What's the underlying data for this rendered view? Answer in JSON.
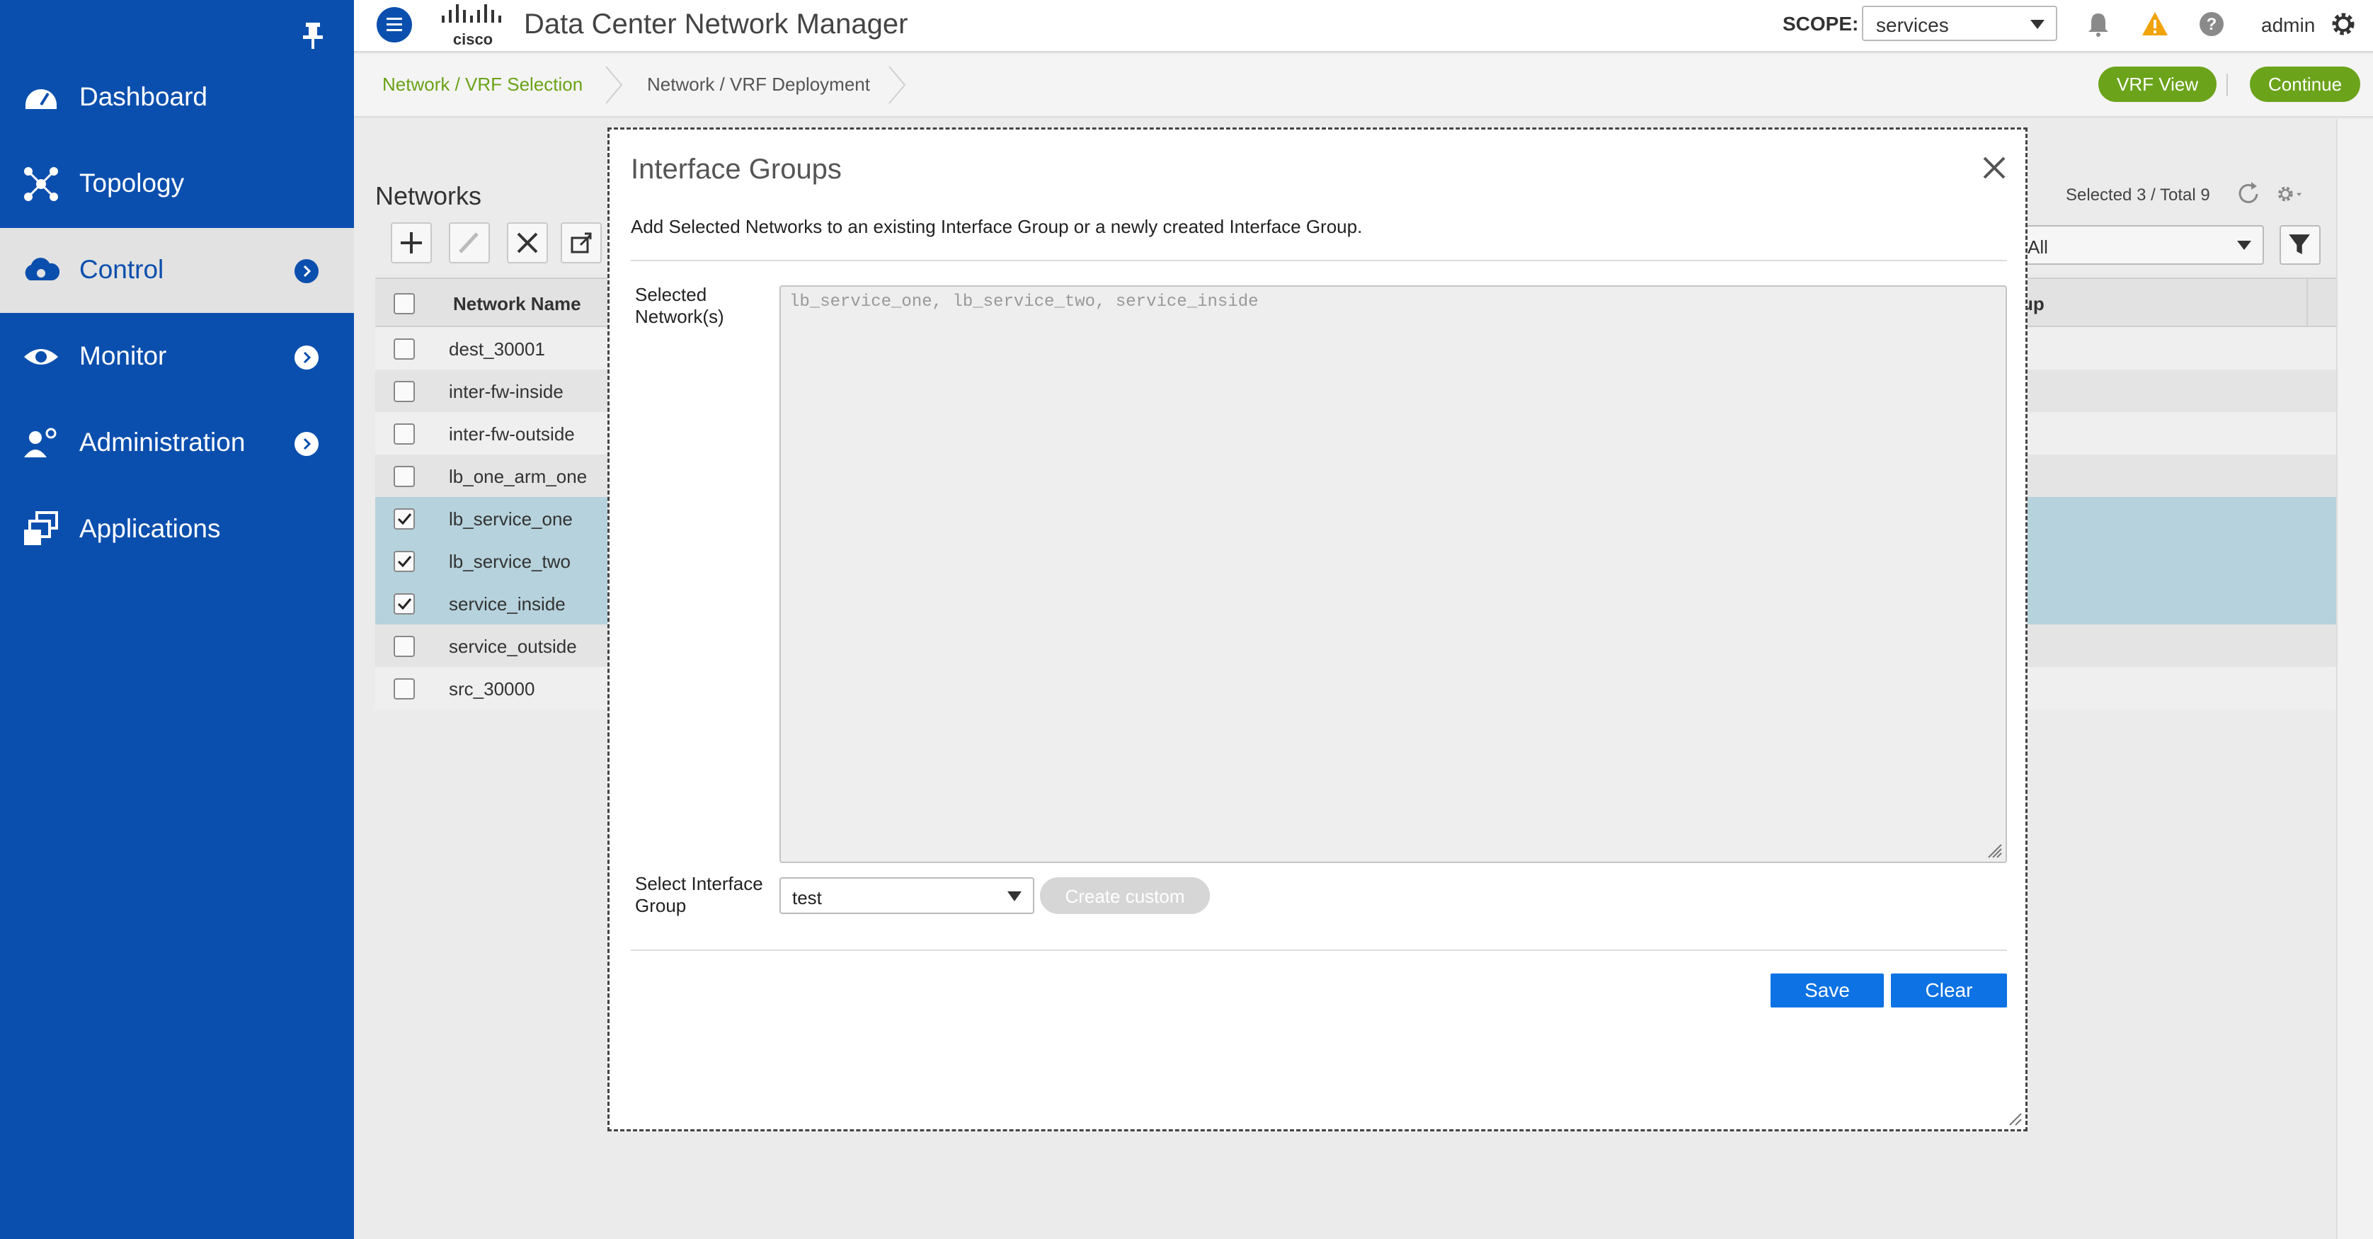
{
  "header": {
    "app_title": "Data Center Network Manager",
    "logo_text": "cisco",
    "scope_label": "SCOPE:",
    "scope_value": "services",
    "user": "admin"
  },
  "sidebar": {
    "items": [
      {
        "label": "Dashboard",
        "icon": "dashboard-icon"
      },
      {
        "label": "Topology",
        "icon": "topology-icon"
      },
      {
        "label": "Control",
        "icon": "control-icon",
        "active": true
      },
      {
        "label": "Monitor",
        "icon": "eye-icon"
      },
      {
        "label": "Administration",
        "icon": "admin-user-icon"
      },
      {
        "label": "Applications",
        "icon": "applications-icon"
      }
    ]
  },
  "breadcrumb": {
    "step1": "Network / VRF Selection",
    "step2": "Network / VRF Deployment"
  },
  "actions": {
    "vrf_view": "VRF View",
    "continue": "Continue"
  },
  "networks": {
    "title": "Networks",
    "selected_total": "Selected 3 / Total 9",
    "filter_value": "All",
    "columns": {
      "name": "Network Name",
      "group_fragment": "up"
    },
    "rows": [
      {
        "name": "dest_30001",
        "checked": false
      },
      {
        "name": "inter-fw-inside",
        "checked": false
      },
      {
        "name": "inter-fw-outside",
        "checked": false
      },
      {
        "name": "lb_one_arm_one",
        "checked": false
      },
      {
        "name": "lb_service_one",
        "checked": true
      },
      {
        "name": "lb_service_two",
        "checked": true
      },
      {
        "name": "service_inside",
        "checked": true
      },
      {
        "name": "service_outside",
        "checked": false
      },
      {
        "name": "src_30000",
        "checked": false
      }
    ]
  },
  "modal": {
    "title": "Interface Groups",
    "description": "Add Selected Networks to an existing Interface Group or a newly created Interface Group.",
    "selected_networks_label_line1": "Selected",
    "selected_networks_label_line2": "Network(s)",
    "selected_networks_value": "lb_service_one, lb_service_two, service_inside",
    "select_group_label_line1": "Select Interface",
    "select_group_label_line2": "Group",
    "select_group_value": "test",
    "create_custom": "Create custom",
    "save": "Save",
    "clear": "Clear"
  },
  "colors": {
    "sidebar_bg": "#0b4fae",
    "accent_green": "#6ba31a",
    "primary_blue": "#0d72e3",
    "selected_row": "#b6d2dc"
  }
}
